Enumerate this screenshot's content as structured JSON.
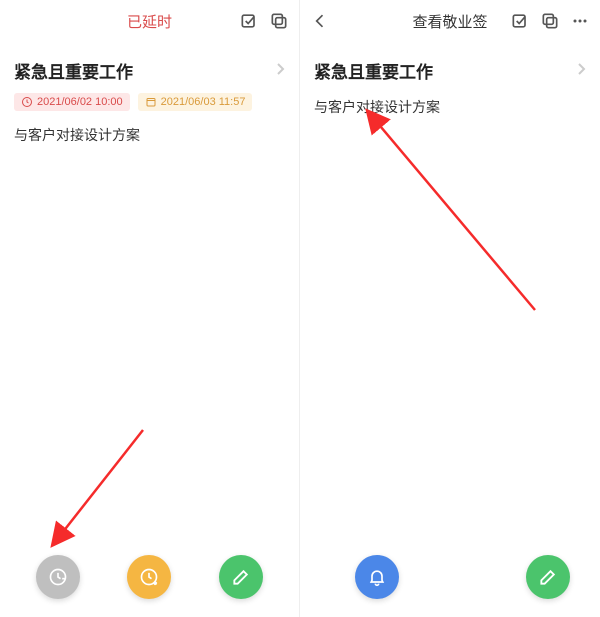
{
  "left": {
    "header": {
      "title": "已延时"
    },
    "section": {
      "title": "紧急且重要工作",
      "badge1": "2021/06/02 10:00",
      "badge2": "2021/06/03 11:57"
    },
    "content": "与客户对接设计方案"
  },
  "right": {
    "header": {
      "title": "查看敬业签"
    },
    "section": {
      "title": "紧急且重要工作"
    },
    "content": "与客户对接设计方案"
  }
}
